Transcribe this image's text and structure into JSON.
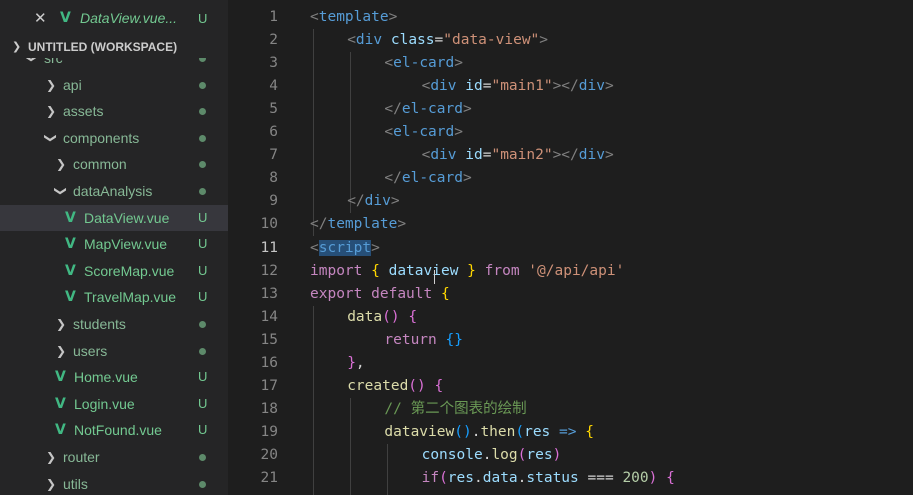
{
  "open_editor": {
    "name": "DataView.vue...",
    "status": "U"
  },
  "workspace": {
    "title": "UNTITLED (WORKSPACE)"
  },
  "tree": [
    {
      "label": "src",
      "kind": "folder",
      "expanded": true,
      "depth": 0,
      "git": "dot"
    },
    {
      "label": "api",
      "kind": "folder",
      "expanded": false,
      "depth": 1,
      "git": "dot"
    },
    {
      "label": "assets",
      "kind": "folder",
      "expanded": false,
      "depth": 1,
      "git": "dot"
    },
    {
      "label": "components",
      "kind": "folder",
      "expanded": true,
      "depth": 1,
      "git": "dot"
    },
    {
      "label": "common",
      "kind": "folder",
      "expanded": false,
      "depth": 2,
      "git": "dot"
    },
    {
      "label": "dataAnalysis",
      "kind": "folder",
      "expanded": true,
      "depth": 2,
      "git": "dot"
    },
    {
      "label": "DataView.vue",
      "kind": "vue",
      "depth": 3,
      "git": "U",
      "selected": true
    },
    {
      "label": "MapView.vue",
      "kind": "vue",
      "depth": 3,
      "git": "U"
    },
    {
      "label": "ScoreMap.vue",
      "kind": "vue",
      "depth": 3,
      "git": "U"
    },
    {
      "label": "TravelMap.vue",
      "kind": "vue",
      "depth": 3,
      "git": "U"
    },
    {
      "label": "students",
      "kind": "folder",
      "expanded": false,
      "depth": 2,
      "git": "dot"
    },
    {
      "label": "users",
      "kind": "folder",
      "expanded": false,
      "depth": 2,
      "git": "dot"
    },
    {
      "label": "Home.vue",
      "kind": "vue",
      "depth": 2,
      "git": "U"
    },
    {
      "label": "Login.vue",
      "kind": "vue",
      "depth": 2,
      "git": "U"
    },
    {
      "label": "NotFound.vue",
      "kind": "vue",
      "depth": 2,
      "git": "U"
    },
    {
      "label": "router",
      "kind": "folder",
      "expanded": false,
      "depth": 1,
      "git": "dot"
    },
    {
      "label": "utils",
      "kind": "folder",
      "expanded": false,
      "depth": 1,
      "git": "dot"
    }
  ],
  "code": {
    "current_line": 11,
    "lines": [
      {
        "n": "1",
        "indent": 0,
        "tokens": [
          [
            "punct",
            "<"
          ],
          [
            "tag",
            "template"
          ],
          [
            "punct",
            ">"
          ]
        ]
      },
      {
        "n": "2",
        "indent": 1,
        "tokens": [
          [
            "punct",
            "<"
          ],
          [
            "tag",
            "div"
          ],
          [
            "txt",
            " "
          ],
          [
            "attr",
            "class"
          ],
          [
            "txt",
            "="
          ],
          [
            "str",
            "\"data-view\""
          ],
          [
            "punct",
            ">"
          ]
        ]
      },
      {
        "n": "3",
        "indent": 2,
        "tokens": [
          [
            "punct",
            "<"
          ],
          [
            "tag",
            "el-card"
          ],
          [
            "punct",
            ">"
          ]
        ]
      },
      {
        "n": "4",
        "indent": 3,
        "tokens": [
          [
            "punct",
            "<"
          ],
          [
            "tag",
            "div"
          ],
          [
            "txt",
            " "
          ],
          [
            "attr",
            "id"
          ],
          [
            "txt",
            "="
          ],
          [
            "str",
            "\"main1\""
          ],
          [
            "punct",
            "></"
          ],
          [
            "tag",
            "div"
          ],
          [
            "punct",
            ">"
          ]
        ]
      },
      {
        "n": "5",
        "indent": 2,
        "tokens": [
          [
            "punct",
            "</"
          ],
          [
            "tag",
            "el-card"
          ],
          [
            "punct",
            ">"
          ]
        ]
      },
      {
        "n": "6",
        "indent": 2,
        "tokens": [
          [
            "punct",
            "<"
          ],
          [
            "tag",
            "el-card"
          ],
          [
            "punct",
            ">"
          ]
        ]
      },
      {
        "n": "7",
        "indent": 3,
        "tokens": [
          [
            "punct",
            "<"
          ],
          [
            "tag",
            "div"
          ],
          [
            "txt",
            " "
          ],
          [
            "attr",
            "id"
          ],
          [
            "txt",
            "="
          ],
          [
            "str",
            "\"main2\""
          ],
          [
            "punct",
            "></"
          ],
          [
            "tag",
            "div"
          ],
          [
            "punct",
            ">"
          ]
        ]
      },
      {
        "n": "8",
        "indent": 2,
        "tokens": [
          [
            "punct",
            "</"
          ],
          [
            "tag",
            "el-card"
          ],
          [
            "punct",
            ">"
          ]
        ]
      },
      {
        "n": "9",
        "indent": 1,
        "tokens": [
          [
            "punct",
            "</"
          ],
          [
            "tag",
            "div"
          ],
          [
            "punct",
            ">"
          ]
        ]
      },
      {
        "n": "10",
        "indent": 0,
        "tokens": [
          [
            "punct",
            "</"
          ],
          [
            "tag",
            "template"
          ],
          [
            "punct",
            ">"
          ]
        ]
      },
      {
        "n": "11",
        "indent": 0,
        "tokens": [
          [
            "punct",
            "<"
          ],
          [
            "sel",
            "script"
          ],
          [
            "punct",
            ">"
          ]
        ]
      },
      {
        "n": "12",
        "indent": 0,
        "tokens": [
          [
            "kw",
            "import"
          ],
          [
            "txt",
            " "
          ],
          [
            "br1",
            "{"
          ],
          [
            "txt",
            " "
          ],
          [
            "var",
            "dataview"
          ],
          [
            "txt",
            " "
          ],
          [
            "br1",
            "}"
          ],
          [
            "txt",
            " "
          ],
          [
            "kw",
            "from"
          ],
          [
            "txt",
            " "
          ],
          [
            "str",
            "'@/api/api'"
          ]
        ]
      },
      {
        "n": "13",
        "indent": 0,
        "tokens": [
          [
            "kw",
            "export"
          ],
          [
            "txt",
            " "
          ],
          [
            "kw",
            "default"
          ],
          [
            "txt",
            " "
          ],
          [
            "br1",
            "{"
          ]
        ]
      },
      {
        "n": "14",
        "indent": 1,
        "tokens": [
          [
            "fn",
            "data"
          ],
          [
            "br2",
            "()"
          ],
          [
            "txt",
            " "
          ],
          [
            "br2",
            "{"
          ]
        ]
      },
      {
        "n": "15",
        "indent": 2,
        "tokens": [
          [
            "kw",
            "return"
          ],
          [
            "txt",
            " "
          ],
          [
            "br3",
            "{}"
          ]
        ]
      },
      {
        "n": "16",
        "indent": 1,
        "tokens": [
          [
            "br2",
            "}"
          ],
          [
            "txt",
            ","
          ]
        ]
      },
      {
        "n": "17",
        "indent": 1,
        "tokens": [
          [
            "fn",
            "created"
          ],
          [
            "br2",
            "()"
          ],
          [
            "txt",
            " "
          ],
          [
            "br2",
            "{"
          ]
        ]
      },
      {
        "n": "18",
        "indent": 2,
        "tokens": [
          [
            "cmt",
            "// 第二个图表的绘制"
          ]
        ]
      },
      {
        "n": "19",
        "indent": 2,
        "tokens": [
          [
            "fn",
            "dataview"
          ],
          [
            "br3",
            "()"
          ],
          [
            "txt",
            "."
          ],
          [
            "fn",
            "then"
          ],
          [
            "br3",
            "("
          ],
          [
            "var",
            "res"
          ],
          [
            "txt",
            " "
          ],
          [
            "tag",
            "=>"
          ],
          [
            "txt",
            " "
          ],
          [
            "br1",
            "{"
          ]
        ]
      },
      {
        "n": "20",
        "indent": 3,
        "tokens": [
          [
            "var",
            "console"
          ],
          [
            "txt",
            "."
          ],
          [
            "fn",
            "log"
          ],
          [
            "br2",
            "("
          ],
          [
            "var",
            "res"
          ],
          [
            "br2",
            ")"
          ]
        ]
      },
      {
        "n": "21",
        "indent": 3,
        "tokens": [
          [
            "kw",
            "if"
          ],
          [
            "br2",
            "("
          ],
          [
            "var",
            "res"
          ],
          [
            "txt",
            "."
          ],
          [
            "var",
            "data"
          ],
          [
            "txt",
            "."
          ],
          [
            "var",
            "status"
          ],
          [
            "txt",
            " === "
          ],
          [
            "num",
            "200"
          ],
          [
            "br2",
            ")"
          ],
          [
            "txt",
            " "
          ],
          [
            "br2",
            "{"
          ]
        ]
      }
    ]
  }
}
